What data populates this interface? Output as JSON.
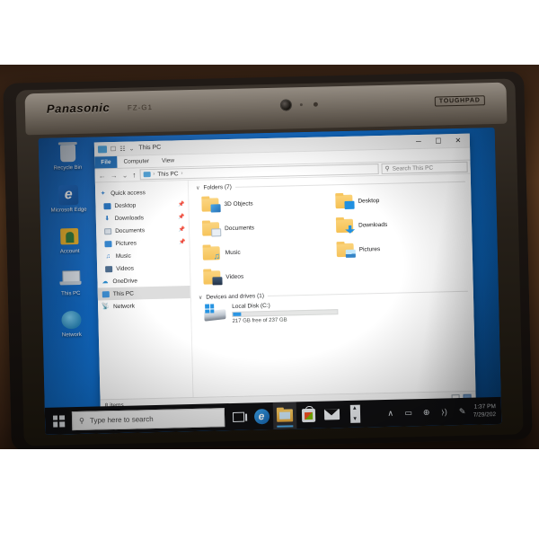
{
  "device": {
    "brand": "Panasonic",
    "model": "FZ-G1",
    "badge": "TOUGHPAD"
  },
  "desktop": {
    "icons": [
      {
        "label": "Recycle Bin",
        "icon": "recycle-bin-icon"
      },
      {
        "label": "Microsoft Edge",
        "icon": "edge-icon"
      },
      {
        "label": "Account",
        "icon": "account-icon"
      },
      {
        "label": "This PC",
        "icon": "this-pc-icon"
      },
      {
        "label": "Network",
        "icon": "network-icon"
      }
    ]
  },
  "explorer": {
    "title": "This PC",
    "quick_access_toolbar": {
      "folder_icon": "folder-icon",
      "properties_icon": "properties-icon",
      "new_folder_icon": "new-folder-icon",
      "customize_icon": "chevron-down-icon"
    },
    "window_controls": {
      "minimize": "─",
      "maximize": "☐",
      "close": "✕"
    },
    "ribbon_tabs": [
      {
        "label": "File",
        "active": true
      },
      {
        "label": "Computer",
        "active": false
      },
      {
        "label": "View",
        "active": false
      }
    ],
    "ribbon_collapse_icon": "chevron-down-icon",
    "ribbon_help_icon": "help-icon",
    "address": {
      "back_icon": "arrow-left-icon",
      "forward_icon": "arrow-right-icon",
      "recent_icon": "chevron-down-icon",
      "up_icon": "arrow-up-icon",
      "crumb_icon": "this-pc-icon",
      "breadcrumb": "This PC",
      "separator": "›"
    },
    "search": {
      "placeholder": "Search This PC",
      "icon": "search-icon"
    },
    "nav_pane": [
      {
        "label": "Quick access",
        "icon": "star-icon",
        "pinned": false,
        "selected": false,
        "root": true
      },
      {
        "label": "Desktop",
        "icon": "desktop-icon",
        "pinned": true,
        "selected": false,
        "root": false
      },
      {
        "label": "Downloads",
        "icon": "downloads-icon",
        "pinned": true,
        "selected": false,
        "root": false
      },
      {
        "label": "Documents",
        "icon": "documents-icon",
        "pinned": true,
        "selected": false,
        "root": false
      },
      {
        "label": "Pictures",
        "icon": "pictures-icon",
        "pinned": true,
        "selected": false,
        "root": false
      },
      {
        "label": "Music",
        "icon": "music-icon",
        "pinned": false,
        "selected": false,
        "root": false
      },
      {
        "label": "Videos",
        "icon": "videos-icon",
        "pinned": false,
        "selected": false,
        "root": false
      },
      {
        "label": "OneDrive",
        "icon": "onedrive-icon",
        "pinned": false,
        "selected": false,
        "root": true
      },
      {
        "label": "This PC",
        "icon": "this-pc-icon",
        "pinned": false,
        "selected": true,
        "root": true
      },
      {
        "label": "Network",
        "icon": "network-icon",
        "pinned": false,
        "selected": false,
        "root": true
      }
    ],
    "groups": {
      "folders": {
        "label": "Folders (7)",
        "chevron": "∨",
        "items": [
          {
            "label": "3D Objects",
            "icon": "3d-objects-folder-icon"
          },
          {
            "label": "Desktop",
            "icon": "desktop-folder-icon"
          },
          {
            "label": "Documents",
            "icon": "documents-folder-icon"
          },
          {
            "label": "Downloads",
            "icon": "downloads-folder-icon"
          },
          {
            "label": "Music",
            "icon": "music-folder-icon"
          },
          {
            "label": "Pictures",
            "icon": "pictures-folder-icon"
          },
          {
            "label": "Videos",
            "icon": "videos-folder-icon"
          }
        ]
      },
      "devices": {
        "label": "Devices and drives (1)",
        "chevron": "∨",
        "items": [
          {
            "name": "Local Disk (C:)",
            "free_text": "217 GB free of 237 GB",
            "used_percent": 8,
            "icon": "hard-drive-icon"
          }
        ]
      }
    },
    "status": {
      "items_count": "8 items",
      "details_view_icon": "details-view-icon",
      "large_icons_view_icon": "large-icons-view-icon"
    }
  },
  "taskbar": {
    "start_label": "start-button",
    "search_placeholder": "Type here to search",
    "search_icon": "search-icon",
    "items": [
      {
        "name": "task-view-button",
        "icon": "task-view-icon",
        "active": false
      },
      {
        "name": "edge-button",
        "icon": "edge-icon",
        "active": false
      },
      {
        "name": "file-explorer-button",
        "icon": "file-explorer-icon",
        "active": true
      },
      {
        "name": "microsoft-store-button",
        "icon": "store-icon",
        "active": false
      },
      {
        "name": "mail-button",
        "icon": "mail-icon",
        "active": false
      },
      {
        "name": "screen-rotation-button",
        "icon": "spinner-icon",
        "active": false
      }
    ],
    "tray": [
      {
        "name": "show-hidden-icons",
        "glyph": "∧"
      },
      {
        "name": "battery-icon",
        "glyph": "▭"
      },
      {
        "name": "network-icon",
        "glyph": "⊕"
      },
      {
        "name": "volume-icon",
        "glyph": "⧽)"
      },
      {
        "name": "pen-icon",
        "glyph": "✎"
      }
    ],
    "clock": {
      "time": "1:37 PM",
      "date": "7/29/202"
    }
  },
  "colors": {
    "accent": "#1e6fbc",
    "taskbar": "#101012",
    "wallpaper": "#1165c4",
    "folder": "#f5bf4e",
    "selection": "#dcdcdc"
  }
}
